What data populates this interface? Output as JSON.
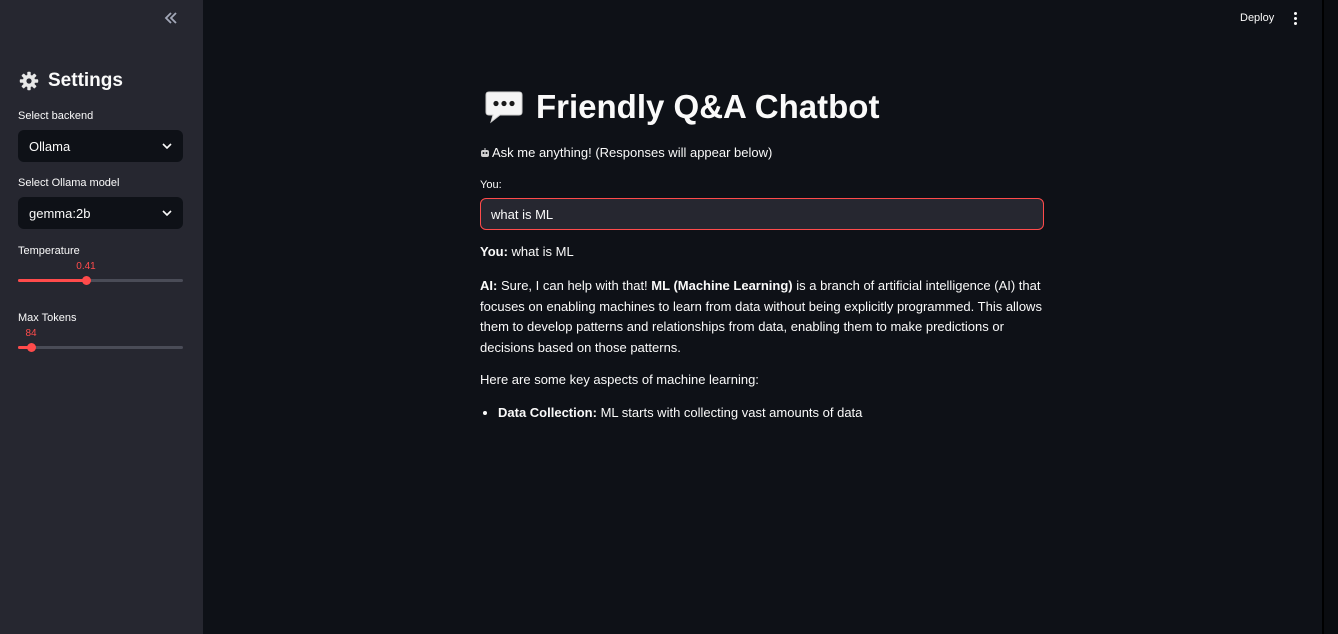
{
  "sidebar": {
    "title": "Settings",
    "backend": {
      "label": "Select backend",
      "value": "Ollama"
    },
    "model": {
      "label": "Select Ollama model",
      "value": "gemma:2b"
    },
    "temperature": {
      "label": "Temperature",
      "value": "0.41",
      "fraction": 0.41
    },
    "max_tokens": {
      "label": "Max Tokens",
      "value": "84",
      "fraction": 0.076
    }
  },
  "header": {
    "deploy_label": "Deploy"
  },
  "main": {
    "title": "Friendly Q&A Chatbot",
    "subtitle": "Ask me anything! (Responses will appear below)",
    "input_label": "You:",
    "input_value": "what is ML",
    "user_message": {
      "speaker": "You:",
      "text": "what is ML"
    },
    "ai_message": {
      "speaker": "AI:",
      "text_1": "Sure, I can help with that!",
      "bold_term": "ML (Machine Learning)",
      "text_2": "is a branch of artificial intelligence (AI) that focuses on enabling machines to learn from data without being explicitly programmed. This allows them to develop patterns and relationships from data, enabling them to make predictions or decisions based on those patterns."
    },
    "aspects_intro": "Here are some key aspects of machine learning:",
    "aspects": [
      {
        "term": "Data Collection:",
        "text": "ML starts with collecting vast amounts of data"
      }
    ]
  },
  "colors": {
    "accent": "#ff4b4b",
    "sidebar_bg": "#262730",
    "main_bg": "#0e1117"
  }
}
